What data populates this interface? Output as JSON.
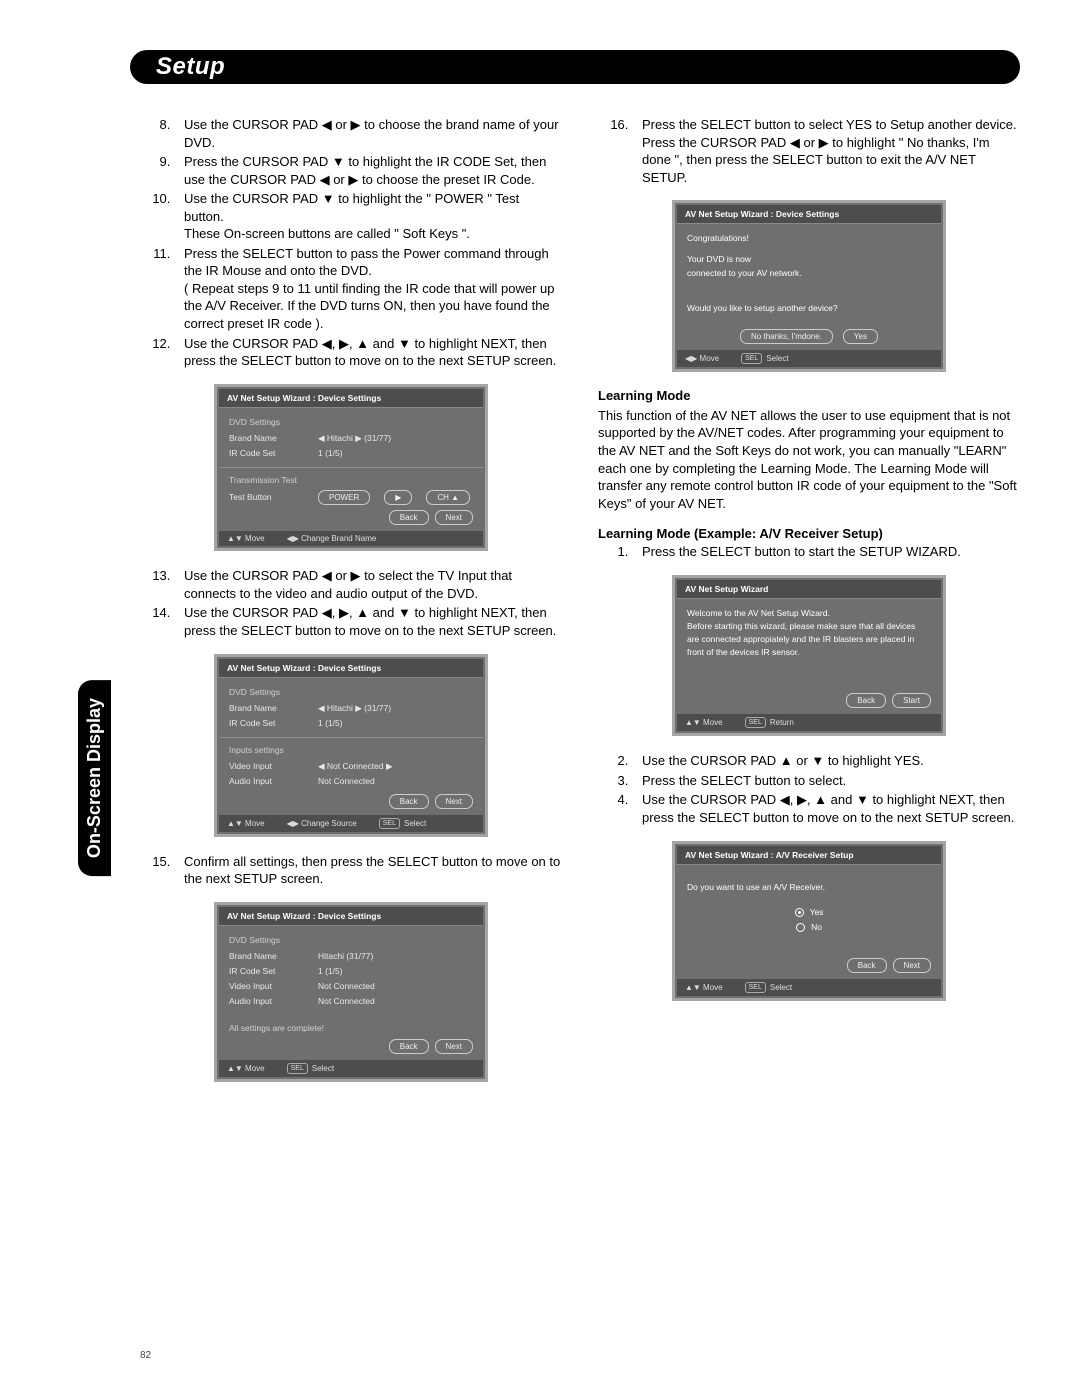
{
  "header": {
    "title": "Setup",
    "side_tab": "On-Screen Display",
    "page_number": "82"
  },
  "arrows": {
    "l": "◀",
    "r": "▶",
    "u": "▲",
    "d": "▼"
  },
  "left": {
    "list1_start": 8,
    "list1": [
      "Use the CURSOR PAD ◀ or ▶ to choose the brand name of your DVD.",
      "Press the CURSOR PAD ▼ to highlight the IR CODE Set, then use the CURSOR PAD ◀ or ▶ to choose the preset IR Code.",
      "Use the CURSOR PAD ▼ to highlight the \" POWER \" Test button.\nThese On-screen buttons are called \" Soft Keys \".",
      "Press the SELECT button to pass the Power command through the IR Mouse and onto the DVD.\n( Repeat steps 9 to 11 until finding the IR code that will power up  the A/V Receiver. If the DVD turns ON, then you have found the correct preset IR code ).",
      "Use the CURSOR PAD ◀, ▶, ▲ and ▼ to highlight NEXT, then press the SELECT button to move on to the next SETUP screen."
    ],
    "list2_start": 13,
    "list2": [
      "Use the CURSOR PAD ◀ or ▶ to select the TV Input that connects to the video and audio output of the DVD.",
      "Use the CURSOR PAD ◀, ▶, ▲ and ▼ to highlight NEXT, then press the SELECT button to move on to the next SETUP screen."
    ],
    "step15_start": 15,
    "step15": "Confirm all settings, then  press the SELECT button to move on to the next SETUP screen."
  },
  "right": {
    "step16_start": 16,
    "step16": "Press the SELECT button to select YES to Setup another device.  Press the CURSOR PAD ◀ or ▶ to highlight \" No thanks, I'm done \", then press the SELECT button to exit the A/V NET SETUP.",
    "learning_head": "Learning Mode",
    "learning_para": "This function of the AV NET allows the user to  use equipment that is not supported by the AV/NET codes. After programming your equipment to the AV NET and the Soft Keys do not work, you can manually \"LEARN\" each one by completing the Learning Mode.  The Learning Mode will transfer any remote control button IR code of your equipment to the \"Soft Keys\" of your AV NET.",
    "example_head": "Learning Mode (Example: A/V Receiver Setup)",
    "ex_list1_start": 1,
    "ex_list1": [
      "Press the SELECT button to start the SETUP WIZARD."
    ],
    "ex_list2_start": 2,
    "ex_list2": [
      "Use the CURSOR PAD ▲ or ▼ to highlight YES.",
      "Press the SELECT button to select.",
      "Use the CURSOR PAD ◀, ▶, ▲ and ▼ to highlight NEXT, then press the SELECT button to move on to the next SETUP screen."
    ]
  },
  "osd_a": {
    "title": "AV Net Setup Wizard : Device Settings",
    "sec1": "DVD Settings",
    "rows1": [
      {
        "k": "Brand Name",
        "v": "◀  Hitachi   ▶   (31/77)"
      },
      {
        "k": "IR Code Set",
        "v": "       1         (1/5)"
      }
    ],
    "sec2": "Transmission Test",
    "test_label": "Test Button",
    "btn_power": "POWER",
    "btn_play": "▶",
    "btn_ch": "CH ▲",
    "back": "Back",
    "next": "Next",
    "foot1": "▲▼  Move",
    "foot2": "◀▶ Change Brand Name"
  },
  "osd_b": {
    "title": "AV Net Setup Wizard : Device Settings",
    "sec1": "DVD Settings",
    "rows1": [
      {
        "k": "Brand Name",
        "v": "◀  Hitachi   ▶   (31/77)"
      },
      {
        "k": "IR Code Set",
        "v": "       1         (1/5)"
      }
    ],
    "sec2": "Inputs settings",
    "rows2": [
      {
        "k": "Video Input",
        "v": "◀  Not Connected  ▶"
      },
      {
        "k": "Audio Input",
        "v": "    Not Connected"
      }
    ],
    "back": "Back",
    "next": "Next",
    "foot1": "▲▼  Move",
    "foot2": "◀▶ Change Source",
    "foot3": "Select"
  },
  "osd_c": {
    "title": "AV Net Setup Wizard : Device Settings",
    "sec1": "DVD Settings",
    "rows": [
      {
        "k": "Brand Name",
        "v": "Hitachi      (31/77)"
      },
      {
        "k": "IR Code Set",
        "v": "1     (1/5)"
      },
      {
        "k": "Video Input",
        "v": "Not Connected"
      },
      {
        "k": "Audio Input",
        "v": "Not Connected"
      }
    ],
    "complete": "All settings are complete!",
    "back": "Back",
    "next": "Next",
    "foot1": "▲▼  Move",
    "foot3": "Select"
  },
  "osd_d": {
    "title": "AV Net Setup Wizard : Device Settings",
    "l1": "Congratulations!",
    "l2": "Your DVD is now",
    "l3": "connected to your AV network.",
    "q": "Would you like to setup another device?",
    "no": "No thanks, I'mdone.",
    "yes": "Yes",
    "foot1": "◀▶ Move",
    "foot3": "Select"
  },
  "osd_e": {
    "title": "AV Net Setup Wizard",
    "l1": "Welcome to the AV Net Setup Wizard.",
    "l2": "Before starting this wizard, please make sure that all devices are connected appropiately and the IR blasters are placed in front of the devices IR sensor.",
    "back": "Back",
    "start": "Start",
    "foot1": "▲▼  Move",
    "foot2": "Return"
  },
  "osd_f": {
    "title": "AV Net Setup Wizard : A/V Receiver Setup",
    "q": "Do you want to use an A/V Receiver.",
    "yes": "Yes",
    "no": "No",
    "back": "Back",
    "next": "Next",
    "foot1": "▲▼  Move",
    "foot3": "Select"
  }
}
